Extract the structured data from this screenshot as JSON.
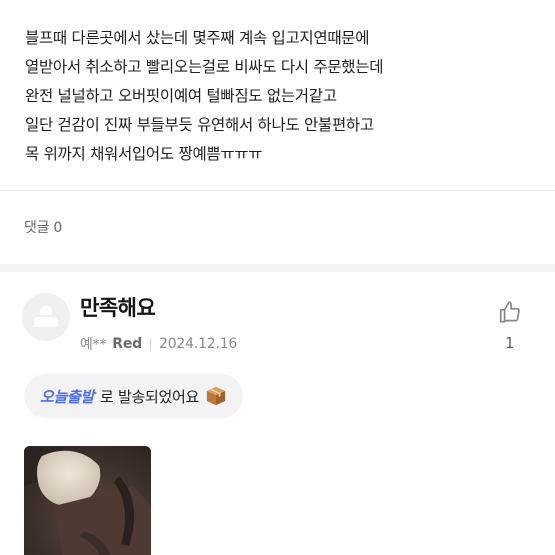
{
  "review_top": {
    "lines": [
      "블프때 다른곳에서 샀는데 몇주째 계속 입고지연때문에",
      "열받아서 취소하고 빨리오는걸로 비싸도 다시 주문했는데",
      "완전 널널하고 오버핏이예여 털빠짐도 없는거같고",
      "일단 걷감이 진짜 부들부듯 유연해서 하나도 안불편하고",
      "목 위까지 채워서입어도 짱예쁨ㅠㅠㅠ"
    ]
  },
  "comments": {
    "label": "댓글",
    "count": "0"
  },
  "review_second": {
    "title": "만족해요",
    "reviewer": "예**",
    "color_option": "Red",
    "date": "2024.12.16",
    "like_count": "1",
    "shipping": {
      "brand": "오늘출발",
      "text": "로 발송되었어요"
    }
  },
  "icons": {
    "avatar": "person-avatar-icon",
    "like": "thumbs-up-icon",
    "box": "package-box-icon"
  }
}
